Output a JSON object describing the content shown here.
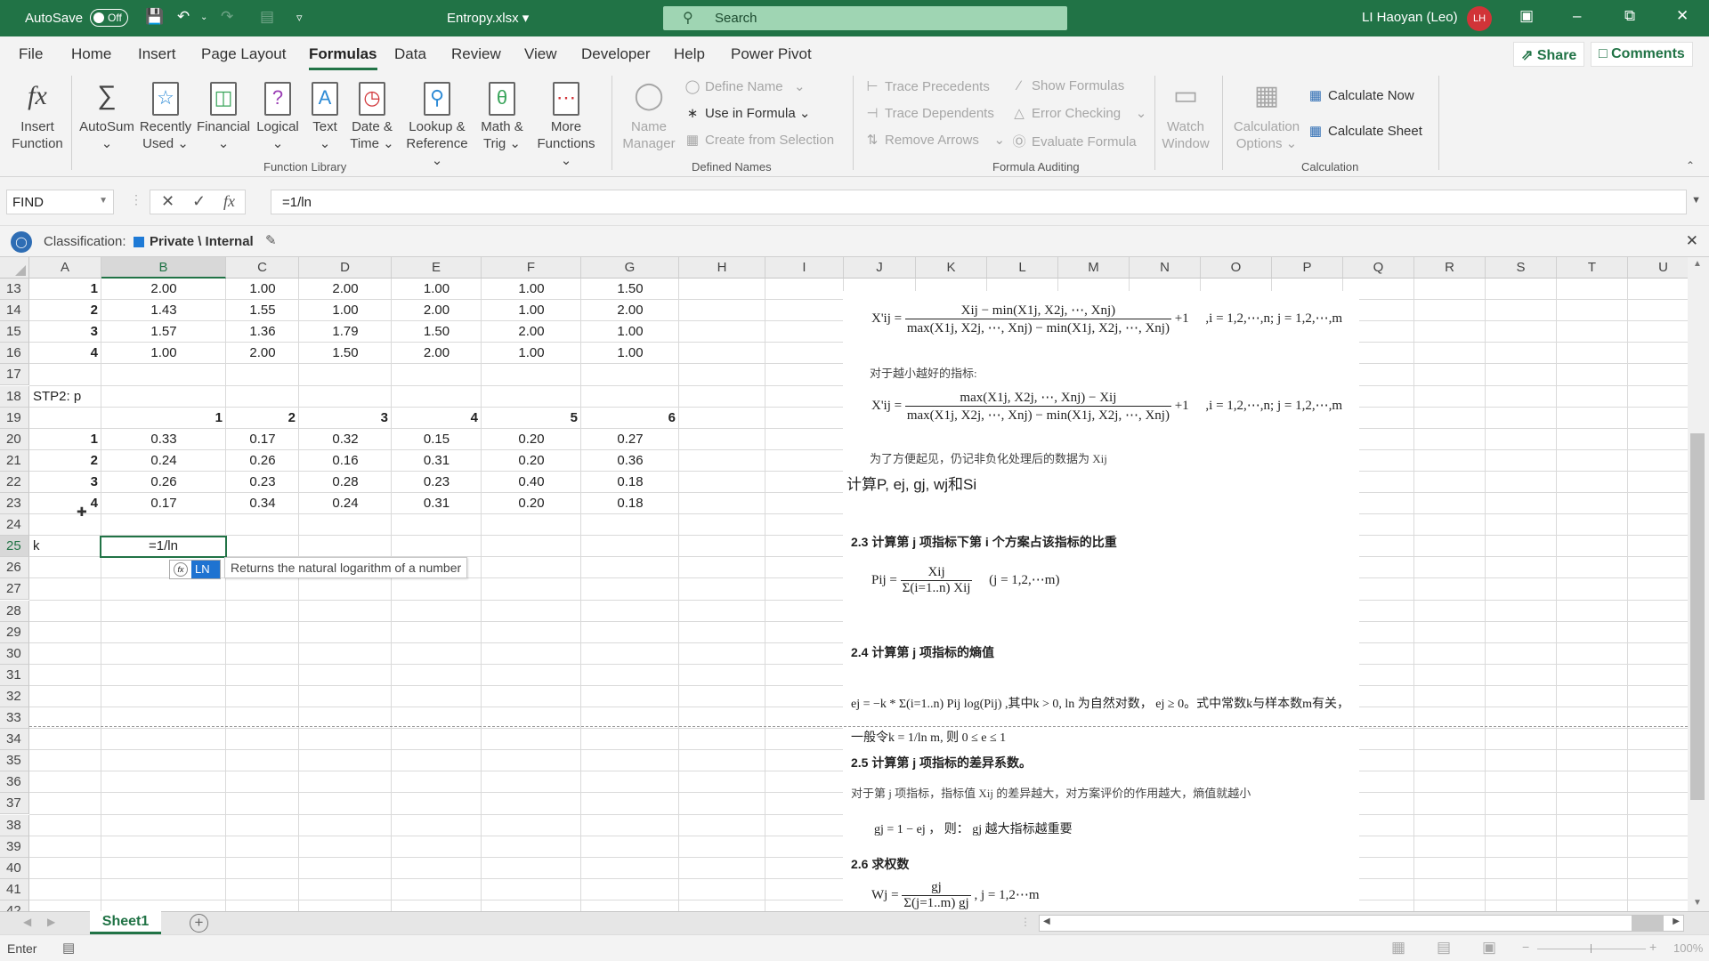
{
  "titlebar": {
    "autosave_label": "AutoSave",
    "autosave_state": "Off",
    "document_title": "Entropy.xlsx",
    "search_placeholder": "Search",
    "user_name": "LI Haoyan (Leo)",
    "user_initials": "LH"
  },
  "menu": {
    "tabs": [
      "File",
      "Home",
      "Insert",
      "Page Layout",
      "Formulas",
      "Data",
      "Review",
      "View",
      "Developer",
      "Help",
      "Power Pivot"
    ],
    "active": "Formulas",
    "share": "Share",
    "comments": "Comments"
  },
  "ribbon": {
    "function_library": {
      "label": "Function Library",
      "insert_function": [
        "Insert",
        "Function"
      ],
      "autosum": "AutoSum",
      "recently_used": [
        "Recently",
        "Used"
      ],
      "financial": "Financial",
      "logical": "Logical",
      "text": "Text",
      "date_time": [
        "Date &",
        "Time"
      ],
      "lookup_reference": [
        "Lookup &",
        "Reference"
      ],
      "math_trig": [
        "Math &",
        "Trig"
      ],
      "more_functions": [
        "More",
        "Functions"
      ]
    },
    "defined_names": {
      "label": "Defined Names",
      "name_manager": [
        "Name",
        "Manager"
      ],
      "define_name": "Define Name",
      "use_in_formula": "Use in Formula",
      "create_from_selection": "Create from Selection"
    },
    "formula_auditing": {
      "label": "Formula Auditing",
      "trace_precedents": "Trace Precedents",
      "trace_dependents": "Trace Dependents",
      "remove_arrows": "Remove Arrows",
      "show_formulas": "Show Formulas",
      "error_checking": "Error Checking",
      "evaluate_formula": "Evaluate Formula",
      "watch_window": [
        "Watch",
        "Window"
      ]
    },
    "calculation": {
      "label": "Calculation",
      "calculation_options": [
        "Calculation",
        "Options"
      ],
      "calculate_now": "Calculate Now",
      "calculate_sheet": "Calculate Sheet"
    }
  },
  "formula_bar": {
    "name_box": "FIND",
    "formula": "=1/ln"
  },
  "classification": {
    "label": "Classification:",
    "value": "Private \\ Internal"
  },
  "columns": [
    "A",
    "B",
    "C",
    "D",
    "E",
    "F",
    "G",
    "H",
    "I",
    "J",
    "K",
    "L",
    "M",
    "N",
    "O",
    "P",
    "Q",
    "R",
    "S",
    "T",
    "U"
  ],
  "rows": [
    "13",
    "14",
    "15",
    "16",
    "17",
    "18",
    "19",
    "20",
    "21",
    "22",
    "23",
    "24",
    "25",
    "26",
    "27",
    "28",
    "29",
    "30",
    "31",
    "32",
    "33",
    "34",
    "35",
    "36",
    "37",
    "38",
    "39",
    "40",
    "41",
    "42"
  ],
  "sheet": {
    "block1": [
      {
        "row": "13",
        "id": "1",
        "values": [
          "2.00",
          "1.00",
          "2.00",
          "1.00",
          "1.00",
          "1.50"
        ]
      },
      {
        "row": "14",
        "id": "2",
        "values": [
          "1.43",
          "1.55",
          "1.00",
          "2.00",
          "1.00",
          "2.00"
        ]
      },
      {
        "row": "15",
        "id": "3",
        "values": [
          "1.57",
          "1.36",
          "1.79",
          "1.50",
          "2.00",
          "1.00"
        ]
      },
      {
        "row": "16",
        "id": "4",
        "values": [
          "1.00",
          "2.00",
          "1.50",
          "2.00",
          "1.00",
          "1.00"
        ]
      }
    ],
    "step2_label": "STP2: p",
    "block2_headers": [
      "1",
      "2",
      "3",
      "4",
      "5",
      "6"
    ],
    "block2": [
      {
        "row": "20",
        "id": "1",
        "values": [
          "0.33",
          "0.17",
          "0.32",
          "0.15",
          "0.20",
          "0.27"
        ]
      },
      {
        "row": "21",
        "id": "2",
        "values": [
          "0.24",
          "0.26",
          "0.16",
          "0.31",
          "0.20",
          "0.36"
        ]
      },
      {
        "row": "22",
        "id": "3",
        "values": [
          "0.26",
          "0.23",
          "0.28",
          "0.23",
          "0.40",
          "0.18"
        ]
      },
      {
        "row": "23",
        "id": "4",
        "values": [
          "0.17",
          "0.34",
          "0.24",
          "0.31",
          "0.20",
          "0.18"
        ]
      }
    ],
    "k_label": "k",
    "active_cell_value": "=1/ln",
    "autocomplete_item": "LN",
    "autocomplete_tooltip": "Returns the natural logarithm of a number",
    "j_note": "计算P, ej, gj, wj和Si"
  },
  "embedded_image": {
    "formula1_left": "X'ij =",
    "formula1_num": "Xij − min(X1j, X2j, ⋯, Xnj)",
    "formula1_den": "max(X1j, X2j, ⋯, Xnj) − min(X1j, X2j, ⋯, Xnj)",
    "formula1_tail": "+1",
    "formula1_range": ",i = 1,2,⋯,n;  j = 1,2,⋯,m",
    "note_smaller_better": "对于越小越好的指标:",
    "formula2_left": "X'ij =",
    "formula2_num": "max(X1j, X2j, ⋯, Xnj) − Xij",
    "formula2_den": "max(X1j, X2j, ⋯, Xnj) − min(X1j, X2j, ⋯, Xnj)",
    "formula2_tail": "+1",
    "formula2_range": ",i = 1,2,⋯,n;  j = 1,2,⋯,m",
    "note_convenience": "为了方便起见，仍记非负化处理后的数据为 Xij",
    "section_2_3": "2.3 计算第 j 项指标下第 i 个方案占该指标的比重",
    "p_formula_left": "Pij =",
    "p_formula_num": "Xij",
    "p_formula_den": "Σ(i=1..n) Xij",
    "p_formula_range": "(j = 1,2,⋯m)",
    "section_2_4": "2.4 计算第 j 项指标的熵值",
    "e_formula": "ej = −k * Σ(i=1..n) Pij log(Pij) ,其中k > 0, ln 为自然对数，  ej ≥ 0。式中常数k与样本数m有关，",
    "k_formula": "一般令k = 1/ln m,  则  0 ≤ e ≤ 1",
    "section_2_5": "2.5 计算第 j 项指标的差异系数。",
    "diff_note": "对于第 j 项指标，指标值 Xij 的差异越大，对方案评价的作用越大，熵值就越小",
    "g_formula": "gj = 1 − ej  ，   则：  gj 越大指标越重要",
    "section_2_6": "2.6 求权数",
    "w_formula_left": "Wj =",
    "w_formula_num": "gj",
    "w_formula_den": "Σ(j=1..m) gj",
    "w_formula_range": ", j = 1,2⋯m"
  },
  "tabs": {
    "sheets": [
      "Sheet1"
    ],
    "active": "Sheet1"
  },
  "status": {
    "mode": "Enter",
    "zoom": "100%"
  }
}
